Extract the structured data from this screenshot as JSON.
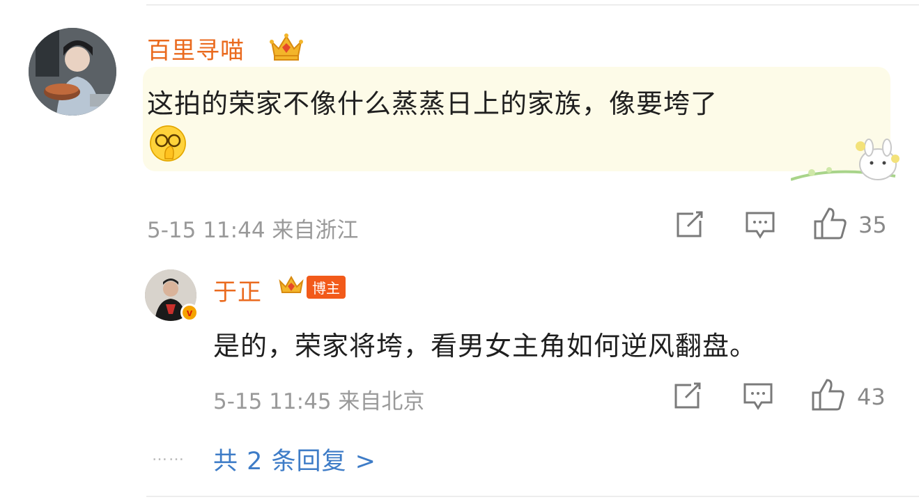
{
  "main_comment": {
    "username": "百里寻喵",
    "badge_icon": "crown-badge-icon",
    "text": "这拍的荣家不像什么蒸蒸日上的家族，像要垮了",
    "emoji": "covering-face-emoji",
    "meta": "5-15 11:44 来自浙江",
    "likes": "35"
  },
  "reply_comment": {
    "username": "于正",
    "badge_label": "博主",
    "verified_label": "v",
    "text": "是的，荣家将垮，看男女主角如何逆风翻盘。",
    "meta": "5-15 11:45 来自北京",
    "likes": "43"
  },
  "more_replies": {
    "dots": "……",
    "label": "共 2 条回复 >"
  },
  "colors": {
    "username": "#ea6a1e",
    "link": "#3e7cc7",
    "meta": "#999999",
    "bubble_bg": "#fdfbe8"
  }
}
